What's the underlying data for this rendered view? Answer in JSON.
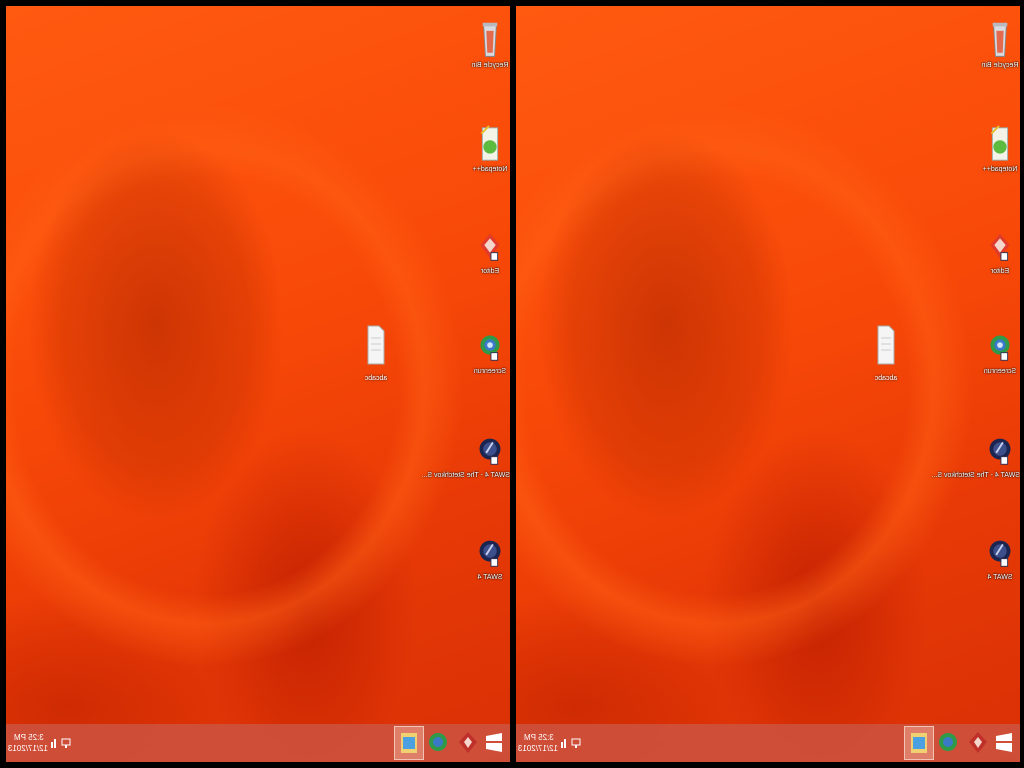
{
  "screens": [
    {
      "desktop_icons": [
        {
          "name": "recycle-bin",
          "label": "Recycle Bin"
        },
        {
          "name": "notepad",
          "label": "Notepad++"
        },
        {
          "name": "editor",
          "label": "Editor"
        },
        {
          "name": "screenrun",
          "label": "Screenrun"
        },
        {
          "name": "swat4-stetchkov",
          "label": "SWAT 4 - The Stetchkov S..."
        },
        {
          "name": "swat4",
          "label": "SWAT 4"
        }
      ],
      "file_icon": {
        "label": "abcabc"
      },
      "taskbar": {
        "time": "3:25 PM",
        "date": "12/17/2013"
      }
    },
    {
      "desktop_icons": [
        {
          "name": "recycle-bin",
          "label": "Recycle Bin"
        },
        {
          "name": "notepad",
          "label": "Notepad++"
        },
        {
          "name": "editor",
          "label": "Editor"
        },
        {
          "name": "screenrun",
          "label": "Screenrun"
        },
        {
          "name": "swat4-stetchkov",
          "label": "SWAT 4 - The Stetchkov S..."
        },
        {
          "name": "swat4",
          "label": "SWAT 4"
        }
      ],
      "file_icon": {
        "label": "abcabc"
      },
      "taskbar": {
        "time": "3:25 PM",
        "date": "12/17/2013"
      }
    }
  ]
}
